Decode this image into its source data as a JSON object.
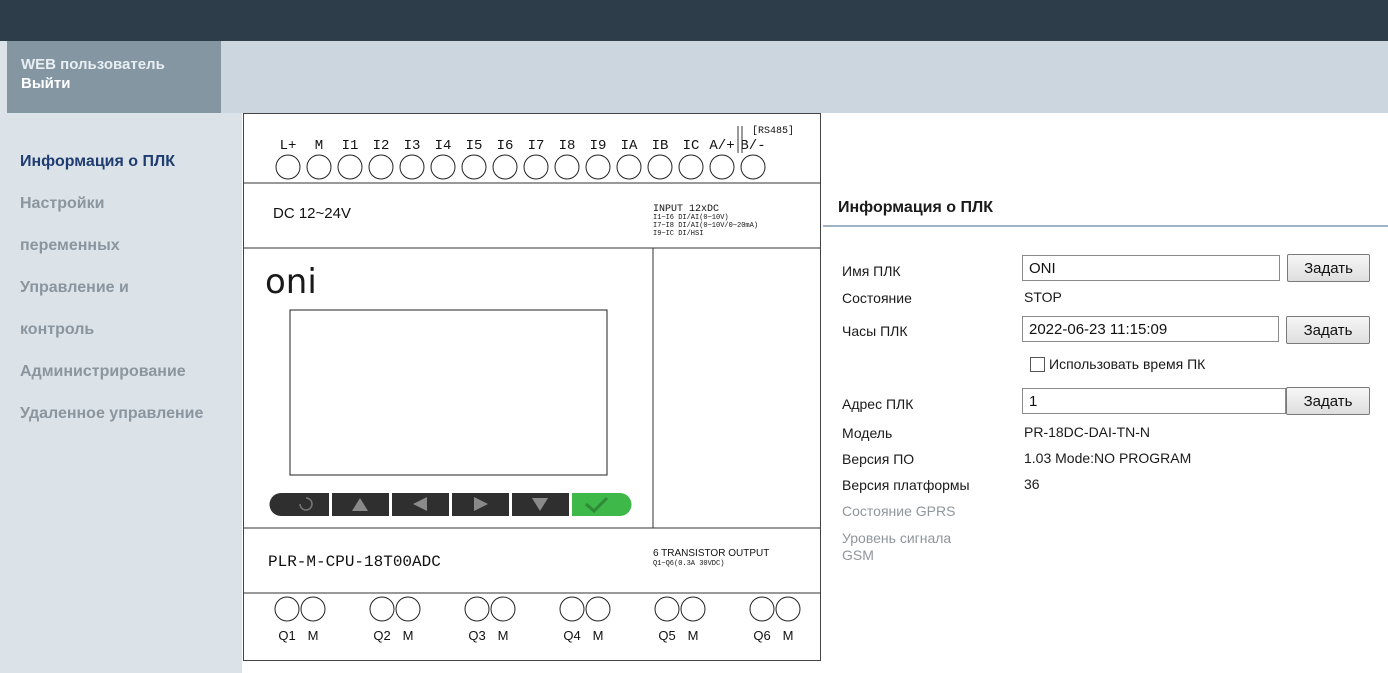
{
  "user": {
    "label": "WEB пользователь",
    "logout": "Выйти"
  },
  "nav": {
    "items": [
      {
        "label": "Информация о ПЛК"
      },
      {
        "label": "Настройки"
      },
      {
        "label": "переменных"
      },
      {
        "label": "Управление и"
      },
      {
        "label": "контроль"
      },
      {
        "label": "Администрирование"
      },
      {
        "label": "Удаленное управление"
      }
    ]
  },
  "plc": {
    "input_terminals": [
      "L+",
      "M",
      "I1",
      "I2",
      "I3",
      "I4",
      "I5",
      "I6",
      "I7",
      "I8",
      "I9",
      "IA",
      "IB",
      "IC",
      "A/+",
      "B/-"
    ],
    "rs485": "[RS485]",
    "power": "DC 12~24V",
    "input_title": "INPUT 12xDC",
    "input_spec": [
      "I1~I6 DI/AI(0~10V)",
      "I7~I8 DI/AI(0~10V/0~20mA)",
      "I9~IC DI/HSI"
    ],
    "logo": "oni",
    "model_text": "PLR-M-CPU-18T00ADC",
    "output_title": "6 TRANSISTOR OUTPUT",
    "output_spec": "Q1~Q6(0.3A 30VDC)",
    "output_labels": [
      "Q1",
      "Q2",
      "Q3",
      "Q4",
      "Q5",
      "Q6"
    ],
    "output_common": "M",
    "keys": [
      "reset-icon",
      "up-arrow-icon",
      "left-arrow-icon",
      "right-arrow-icon",
      "down-arrow-icon",
      "check-icon"
    ]
  },
  "info": {
    "title": "Информация о ПЛК",
    "name_label": "Имя ПЛК",
    "name_value": "ONI",
    "set_label": "Задать",
    "state_label": "Состояние",
    "state_value": "STOP",
    "clock_label": "Часы ПЛК",
    "clock_value": "2022-06-23 11:15:09",
    "use_pc_time": "Использовать время ПК",
    "address_label": "Адрес ПЛК",
    "address_value": "1",
    "model_label": "Модель",
    "model_value": "PR-18DC-DAI-TN-N",
    "fw_label": "Версия ПО",
    "fw_value": "1.03 Mode:NO PROGRAM",
    "platform_label": "Версия платформы",
    "platform_value": "36",
    "gprs_label": "Состояние GPRS",
    "gsm_label_1": "Уровень сигнала",
    "gsm_label_2": "GSM"
  },
  "colors": {
    "topbar": "#2e3d4a",
    "user_panel": "#8596a3",
    "nav_active": "#1f3d70",
    "nav_inactive": "#8a959e",
    "ok_key": "#3fb84a",
    "key_dark": "#2f2f2f"
  }
}
